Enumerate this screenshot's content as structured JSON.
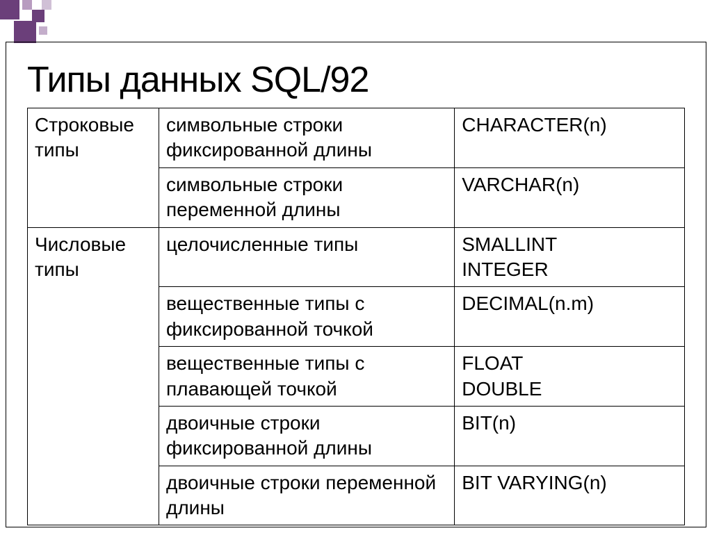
{
  "title": "Типы данных SQL/92",
  "table": {
    "rows": [
      {
        "category": "Строковые типы",
        "category_rowspan": 2,
        "description": "символьные строки фиксированной длины",
        "sql_type": "CHARACTER(n)"
      },
      {
        "description": "символьные строки переменной длины",
        "sql_type": "VARCHAR(n)"
      },
      {
        "category": "Числовые типы",
        "category_rowspan": 5,
        "description": "целочисленные типы",
        "sql_type": "SMALLINT\nINTEGER"
      },
      {
        "description": "вещественные типы с фиксированной точкой",
        "sql_type": "DECIMAL(n.m)"
      },
      {
        "description": "вещественные типы с плавающей точкой",
        "sql_type": "FLOAT\nDOUBLE"
      },
      {
        "description": "двоичные строки фиксированной длины",
        "sql_type": "BIT(n)"
      },
      {
        "description": "двоичные строки переменной длины",
        "sql_type": "BIT VARYING(n)"
      }
    ]
  }
}
